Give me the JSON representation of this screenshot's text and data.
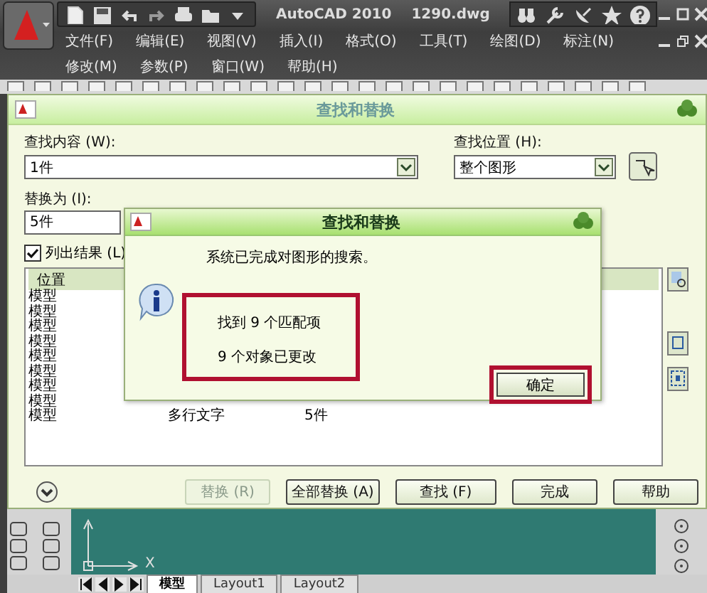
{
  "app_bar": {
    "title": "AutoCAD 2010",
    "file": "1290.dwg"
  },
  "menu_rows": [
    [
      "文件(F)",
      "编辑(E)",
      "视图(V)",
      "插入(I)",
      "格式(O)",
      "工具(T)",
      "绘图(D)",
      "标注(N)"
    ],
    [
      "修改(M)",
      "参数(P)",
      "窗口(W)",
      "帮助(H)"
    ]
  ],
  "dialog": {
    "title": "查找和替换",
    "find_label": "查找内容 (W):",
    "find_value": "1件",
    "where_label": "查找位置 (H):",
    "where_value": "整个图形",
    "replace_label": "替换为 (I):",
    "replace_value": "5件",
    "list_results": {
      "label": "列出结果 (L)",
      "checked": true
    },
    "results": {
      "columns": [
        "位置"
      ],
      "rows": [
        [
          "模型"
        ],
        [
          "模型"
        ],
        [
          "模型"
        ],
        [
          "模型"
        ],
        [
          "模型"
        ],
        [
          "模型"
        ],
        [
          "模型"
        ],
        [
          "模型"
        ],
        [
          "模型",
          "多行文字",
          "5件"
        ]
      ]
    },
    "buttons": [
      {
        "label": "替换 (R)",
        "disabled": true
      },
      {
        "label": "全部替换 (A)",
        "disabled": false
      },
      {
        "label": "查找 (F)",
        "disabled": false
      },
      {
        "label": "完成",
        "disabled": false
      },
      {
        "label": "帮助",
        "disabled": false
      }
    ]
  },
  "message": {
    "title": "查找和替换",
    "text": "系统已完成对图形的搜索。",
    "lines": [
      "找到 9 个匹配项",
      "9 个对象已更改"
    ],
    "ok": "确定"
  },
  "canvas": {
    "axis_label": "X"
  },
  "layout_tabs": [
    {
      "label": "模型",
      "selected": true
    },
    {
      "label": "Layout1",
      "selected": false
    },
    {
      "label": "Layout2",
      "selected": false
    }
  ]
}
